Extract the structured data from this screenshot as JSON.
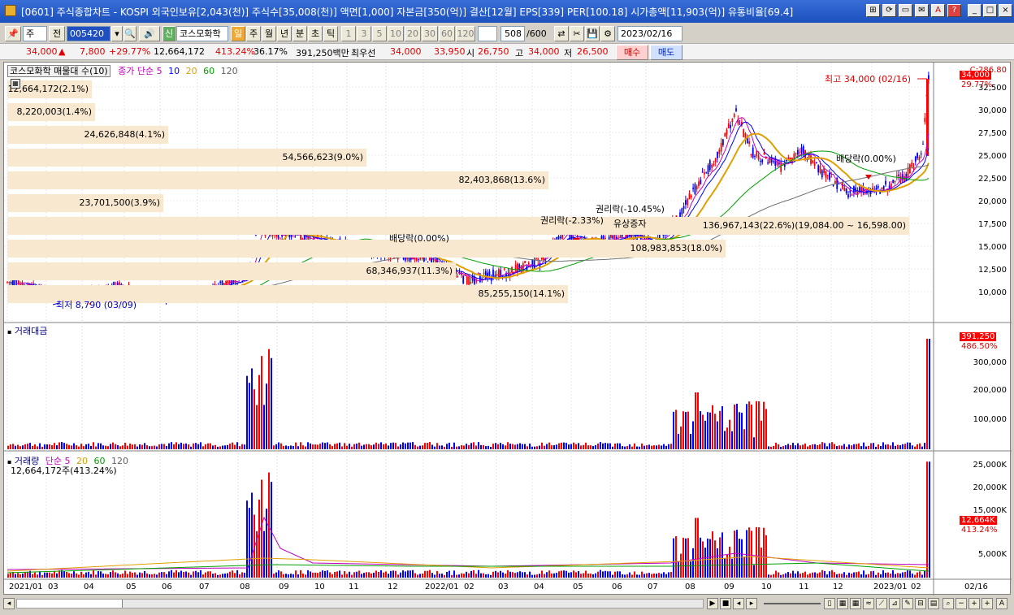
{
  "window": {
    "title": "[0601] 주식종합차트 - KOSPI 외국인보유[2,043(천)] 주식수[35,008(천)] 액면[1,000] 자본금[350(억)] 결산[12월] EPS[339] PER[100.18] 시가총액[11,903(억)] 유통비율[69.4]",
    "controls": [
      "⊞",
      "⟳",
      "▭",
      "✉",
      "A",
      "?",
      "_",
      "□",
      "×"
    ]
  },
  "toolbar": {
    "period_select": "주",
    "prev_label": "전",
    "code": "005420",
    "stock_badge": "신",
    "stock_name": "코스모화학",
    "periods": [
      "일",
      "주",
      "월",
      "년",
      "분",
      "초",
      "틱"
    ],
    "selected_period": "일",
    "intervals": [
      "1",
      "3",
      "5",
      "10",
      "20",
      "30",
      "60",
      "120"
    ],
    "count": "508",
    "count_total": "/600",
    "date": "2023/02/16"
  },
  "quote": {
    "price": "34,000",
    "change_arrow": "▲",
    "change": "7,800",
    "change_pct": "+29.77%",
    "volume": "12,664,172",
    "volume_ratio": "413.24%",
    "turnover": "36.17%",
    "amount": "391,250백만",
    "best_ask_label": "최우선",
    "best_ask": "34,000",
    "best_bid": "33,950",
    "open_label": "시",
    "open": "26,750",
    "high_label": "고",
    "high": "34,000",
    "low_label": "저",
    "low": "26,500",
    "buy_label": "매수",
    "sell_label": "매도"
  },
  "price_panel": {
    "header_name": "코스모화학 매물대 수(10)",
    "header_ma": "종가 단순 5",
    "ma_periods": [
      "10",
      "20",
      "60",
      "120"
    ],
    "ma_colors": {
      "5": "#c000c0",
      "10": "#0000ff",
      "20": "#d8a000",
      "60": "#00a000",
      "120": "#606060"
    },
    "top_label": "C:286.80",
    "price_tag": "34,000",
    "price_pct_tag": "29.77%",
    "high_annot": "최고 34,000 (02/16)",
    "low_annot": "최저 8,790 (03/09)",
    "y_ticks": [
      "32,500",
      "30,000",
      "27,500",
      "25,000",
      "22,500",
      "20,000",
      "17,500",
      "15,000",
      "12,500",
      "10,000"
    ],
    "volume_profile": [
      "12,664,172(2.1%)",
      "8,220,003(1.4%)",
      "24,626,848(4.1%)",
      "54,566,623(9.0%)",
      "82,403,868(13.6%)",
      "23,701,500(3.9%)",
      "136,967,143(22.6%)(19,084.00 ~ 16,598.00)",
      "108,983,853(18.0%)",
      "68,346,937(11.3%)",
      "85,255,150(14.1%)"
    ],
    "events": [
      "배당락(0.00%)",
      "권리락(-2.33%)",
      "권리락(-10.45%)",
      "유상증자",
      "배당락(0.00%)"
    ]
  },
  "amount_panel": {
    "header": "거래대금",
    "tag_value": "391,250",
    "tag_pct": "486.50%",
    "y_ticks": [
      "300,000",
      "200,000",
      "100,000"
    ]
  },
  "volume_panel": {
    "header": "거래량",
    "header_ma": "단순 5",
    "ma_periods": [
      "20",
      "60",
      "120"
    ],
    "sub_header": "12,664,172주(413.24%)",
    "tag_value": "12,664K",
    "tag_pct": "413.24%",
    "y_ticks": [
      "25,000K",
      "20,000K",
      "15,000K",
      "10,000K",
      "5,000K"
    ]
  },
  "x_axis": [
    "2021/01",
    "03",
    "04",
    "05",
    "06",
    "07",
    "08",
    "09",
    "10",
    "11",
    "12",
    "2022/01",
    "02",
    "03",
    "04",
    "05",
    "06",
    "07",
    "08",
    "09",
    "10",
    "11",
    "12",
    "2023/01",
    "02"
  ],
  "x_axis_end": "02/16",
  "colors": {
    "up": "#ff0000",
    "down": "#0000ff",
    "band": "#f8e8d0",
    "accent": "#f0a830"
  }
}
